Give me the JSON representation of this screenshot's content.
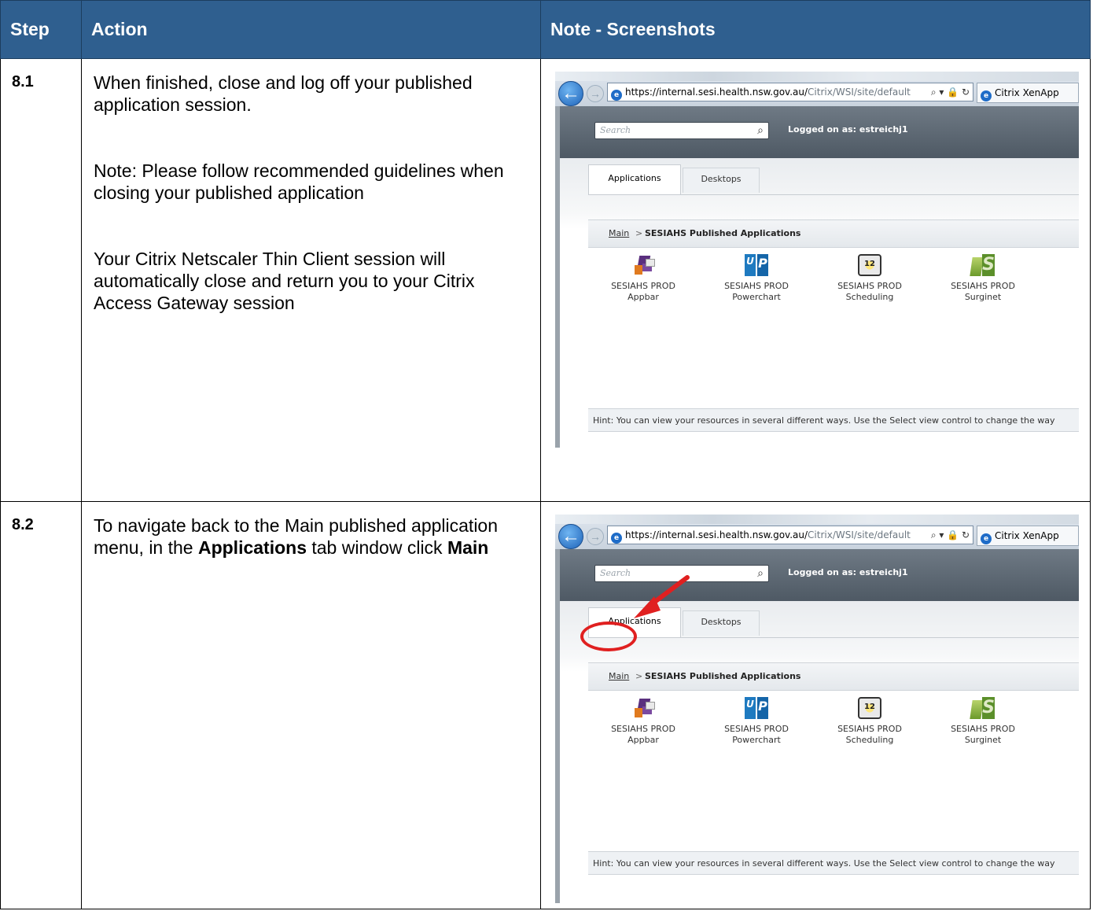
{
  "table": {
    "headers": {
      "step": "Step",
      "action": "Action",
      "note": "Note - Screenshots"
    },
    "rows": [
      {
        "step": "8.1",
        "action": {
          "p1": "When finished, close and log off your published application session.",
          "p2": "Note: Please follow recommended guidelines when closing your published application",
          "p3": "Your Citrix Netscaler Thin Client session will automatically close and return you to your Citrix Access Gateway session"
        }
      },
      {
        "step": "8.2",
        "action": {
          "pre": "To navigate back to the Main published application menu, in the ",
          "b1": "Applications",
          "mid": " tab window click ",
          "b2": "Main"
        }
      }
    ]
  },
  "screenshot": {
    "url_host": "https://internal.sesi.health.nsw.gov.au/",
    "url_path": "Citrix/WSI/site/default",
    "address_controls": "⌕ ▾ 🔒 ↻",
    "tab_title": "Citrix XenApp",
    "search_placeholder": "Search",
    "logged_on": "Logged on as: estreichj1",
    "tab_applications": "Applications",
    "tab_desktops": "Desktops",
    "breadcrumb_main": "Main",
    "breadcrumb_sep": ">",
    "breadcrumb_current": "SESIAHS Published Applications",
    "apps": [
      {
        "line1": "SESIAHS PROD",
        "line2": "Appbar",
        "icon": "appbar-icon"
      },
      {
        "line1": "SESIAHS PROD",
        "line2": "Powerchart",
        "icon": "powerchart-icon"
      },
      {
        "line1": "SESIAHS PROD",
        "line2": "Scheduling",
        "icon": "scheduling-icon"
      },
      {
        "line1": "SESIAHS PROD",
        "line2": "Surginet",
        "icon": "surginet-icon"
      }
    ],
    "hint": "Hint: You can view your resources in several different ways. Use the Select view control to change the way",
    "annotation_color": "#e02020"
  },
  "colors": {
    "header_bg": "#2f5f8f",
    "header_text": "#ffffff"
  }
}
